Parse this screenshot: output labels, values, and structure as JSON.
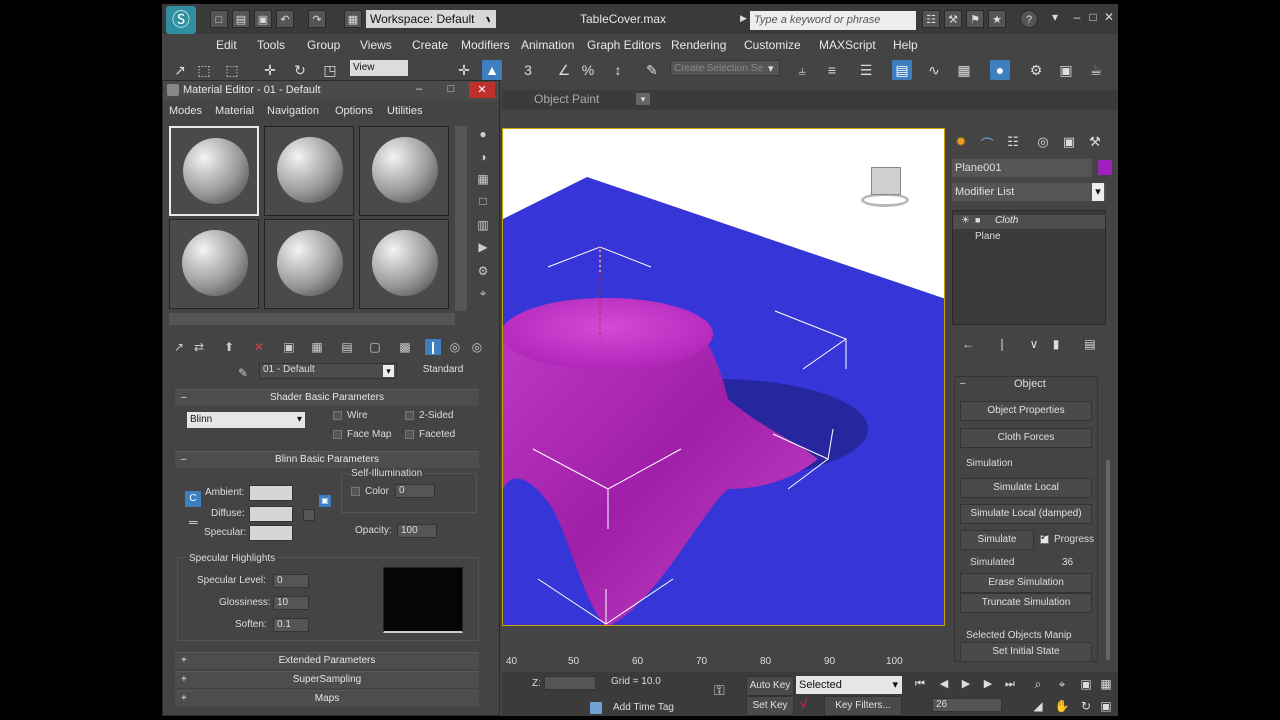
{
  "app": {
    "workspace": "Workspace: Default",
    "file_title": "TableCover.max",
    "search_placeholder": "Type a keyword or phrase"
  },
  "menu": [
    "Edit",
    "Tools",
    "Group",
    "Views",
    "Create",
    "Modifiers",
    "Animation",
    "Graph Editors",
    "Rendering",
    "Customize",
    "MAXScript",
    "Help"
  ],
  "toolbar": {
    "view_dropdown": "View",
    "selection_set": "Create Selection Se",
    "ribbon_label": "Object Paint"
  },
  "material_editor": {
    "title": "Material Editor - 01 - Default",
    "menus": [
      "Modes",
      "Material",
      "Navigation",
      "Options",
      "Utilities"
    ],
    "material_name": "01 - Default",
    "material_type": "Standard",
    "shader_rollout": "Shader Basic Parameters",
    "shader": "Blinn",
    "shader_options": {
      "wire": "Wire",
      "two_sided": "2-Sided",
      "face_map": "Face Map",
      "faceted": "Faceted"
    },
    "blinn_rollout": "Blinn Basic Parameters",
    "self_illum": "Self-Illumination",
    "color_label": "Color",
    "color_value": "0",
    "ambient": "Ambient:",
    "diffuse": "Diffuse:",
    "specular": "Specular:",
    "opacity_label": "Opacity:",
    "opacity_value": "100",
    "spec_highlights": "Specular Highlights",
    "spec_level_label": "Specular Level:",
    "spec_level": "0",
    "glossiness_label": "Glossiness:",
    "glossiness": "10",
    "soften_label": "Soften:",
    "soften": "0.1",
    "rollouts_collapsed": [
      "Extended Parameters",
      "SuperSampling",
      "Maps"
    ]
  },
  "command_panel": {
    "object_name": "Plane001",
    "object_color": "#a020c0",
    "modifier_list": "Modifier List",
    "stack": [
      "Cloth",
      "Plane"
    ],
    "section_object": "Object",
    "btn_object_properties": "Object Properties",
    "btn_cloth_forces": "Cloth Forces",
    "section_simulation": "Simulation",
    "btn_simulate_local": "Simulate Local",
    "btn_simulate_local_damped": "Simulate Local (damped)",
    "btn_simulate": "Simulate",
    "progress_label": "Progress",
    "simulated_label": "Simulated",
    "simulated_value": "36",
    "btn_erase": "Erase Simulation",
    "btn_truncate": "Truncate Simulation",
    "section_manip": "Selected Objects Manip",
    "btn_set_initial": "Set Initial State"
  },
  "timeline": {
    "ticks": [
      "40",
      "50",
      "60",
      "70",
      "80",
      "90",
      "100"
    ]
  },
  "status": {
    "z_label": "Z:",
    "grid": "Grid = 10.0",
    "add_time_tag": "Add Time Tag",
    "auto_key": "Auto Key",
    "set_key": "Set Key",
    "selected": "Selected",
    "key_filters": "Key Filters...",
    "frame": "26"
  }
}
